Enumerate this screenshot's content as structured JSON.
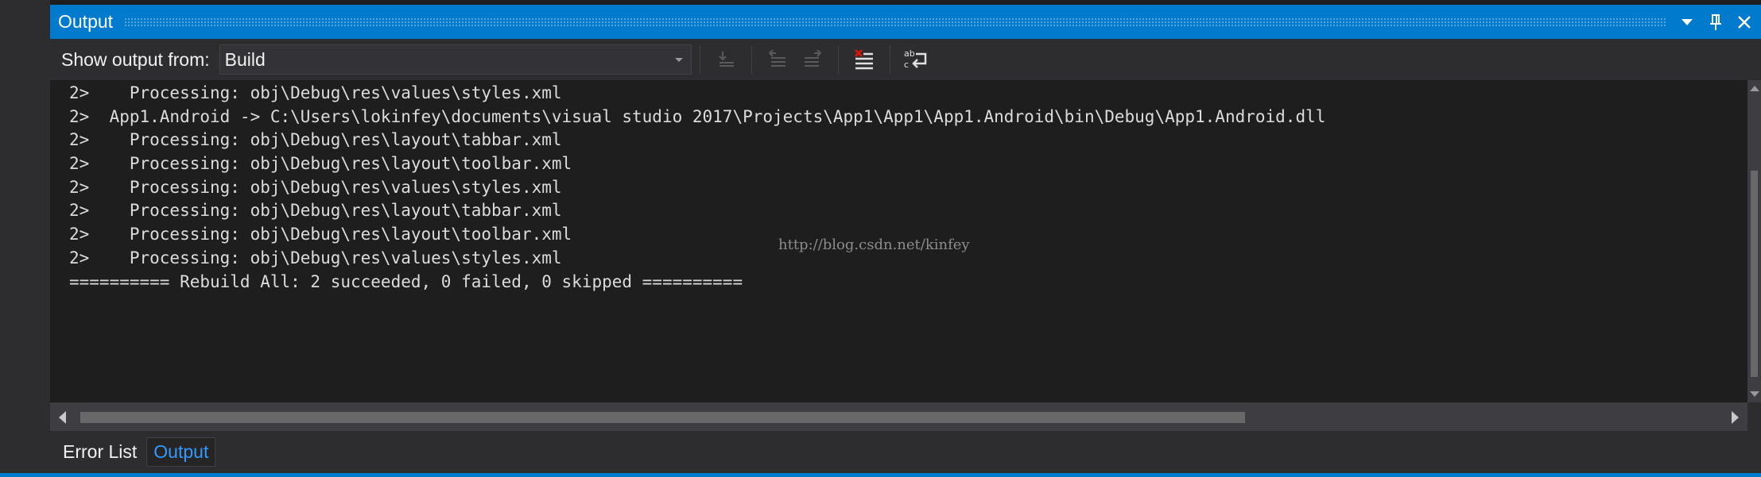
{
  "window": {
    "title": "Output",
    "buttons": [
      "dropdown-icon",
      "pin-icon",
      "close-icon"
    ]
  },
  "toolbar": {
    "show_label": "Show output from:",
    "source_selected": "Build",
    "icons": [
      "go-to-line-icon",
      "previous-message-icon",
      "next-message-icon",
      "clear-all-icon",
      "word-wrap-icon"
    ]
  },
  "output": {
    "lines": [
      "2>    Processing: obj\\Debug\\res\\values\\styles.xml",
      "2>  App1.Android -> C:\\Users\\lokinfey\\documents\\visual studio 2017\\Projects\\App1\\App1\\App1.Android\\bin\\Debug\\App1.Android.dll",
      "2>    Processing: obj\\Debug\\res\\layout\\tabbar.xml",
      "2>    Processing: obj\\Debug\\res\\layout\\toolbar.xml",
      "2>    Processing: obj\\Debug\\res\\values\\styles.xml",
      "2>    Processing: obj\\Debug\\res\\layout\\tabbar.xml",
      "2>    Processing: obj\\Debug\\res\\layout\\toolbar.xml",
      "2>    Processing: obj\\Debug\\res\\values\\styles.xml",
      "========== Rebuild All: 2 succeeded, 0 failed, 0 skipped =========="
    ],
    "watermark": "http://blog.csdn.net/kinfey"
  },
  "tabs": [
    {
      "label": "Error List",
      "active": false
    },
    {
      "label": "Output",
      "active": true
    }
  ],
  "colors": {
    "accent": "#007acc",
    "active_tab_text": "#3399ff",
    "panel_bg": "#1e1e1e",
    "chrome_bg": "#2d2d30"
  }
}
